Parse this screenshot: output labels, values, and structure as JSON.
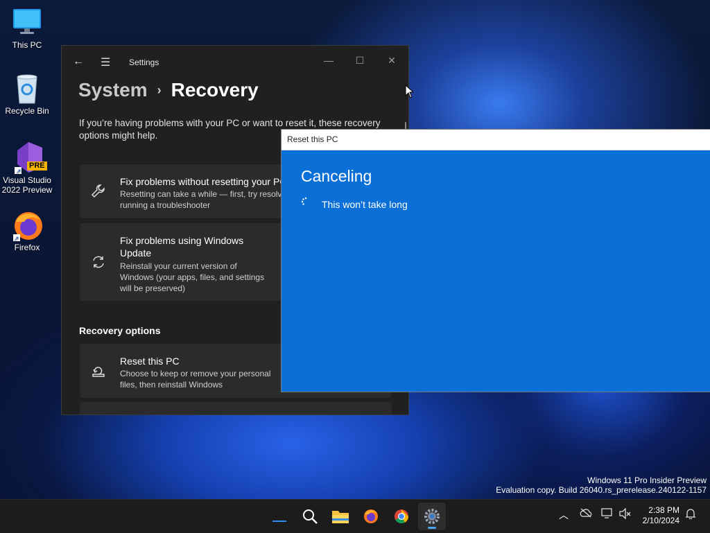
{
  "desktop": {
    "icons": [
      {
        "label": "This PC",
        "icon": "monitor-icon"
      },
      {
        "label": "Recycle Bin",
        "icon": "recycle-bin-icon"
      },
      {
        "label_line1": "Visual Studio",
        "label_line2": "2022 Preview",
        "badge": "PRE",
        "icon": "visual-studio-icon"
      },
      {
        "label": "Firefox",
        "icon": "firefox-icon"
      }
    ]
  },
  "settings": {
    "app_title": "Settings",
    "breadcrumb_parent": "System",
    "breadcrumb_separator": "›",
    "breadcrumb_current": "Recovery",
    "intro": "If you’re having problems with your PC or want to reset it, these recovery options might help.",
    "cards": [
      {
        "title": "Fix problems without resetting your PC",
        "desc_line1": "Resetting can take a while — first, try resolving issues by",
        "desc_line2": "running a troubleshooter",
        "icon": "wrench-icon"
      },
      {
        "title_line1": "Fix problems using Windows",
        "title_line2": "Update",
        "desc_line1": "Reinstall your current version of",
        "desc_line2": "Windows (your apps, files, and settings",
        "desc_line3": "will be preserved)",
        "icon": "sync-icon"
      }
    ],
    "section_title": "Recovery options",
    "reset_card": {
      "title": "Reset this PC",
      "desc_line1": "Choose to keep or remove your personal",
      "desc_line2": "files, then reinstall Windows",
      "icon": "reset-pc-icon"
    }
  },
  "reset_dialog": {
    "window_title": "Reset this PC",
    "heading": "Canceling",
    "subtext": "This won’t take long",
    "bg_color": "#0a6fd6"
  },
  "watermark": {
    "line1": "Windows 11 Pro Insider Preview",
    "line2": "Evaluation copy. Build 26040.rs_prerelease.240122-1157"
  },
  "taskbar": {
    "apps": [
      "start-icon",
      "search-icon",
      "file-explorer-icon",
      "firefox-icon",
      "chrome-icon",
      "settings-icon"
    ],
    "time": "2:38 PM",
    "date": "2/10/2024"
  }
}
